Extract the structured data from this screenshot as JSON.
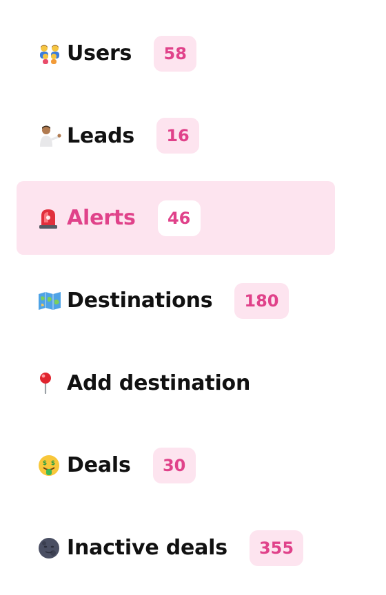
{
  "nav": {
    "items": [
      {
        "icon": "family-icon",
        "emoji": "👨‍👩‍👧‍👦",
        "label": "Users",
        "count": "58",
        "active": false
      },
      {
        "icon": "person-tipping-hand-icon",
        "emoji": "💁🏽‍♂️",
        "label": "Leads",
        "count": "16",
        "active": false
      },
      {
        "icon": "police-light-icon",
        "emoji": "🚨",
        "label": "Alerts",
        "count": "46",
        "active": true
      },
      {
        "icon": "world-map-icon",
        "emoji": "🗺️",
        "label": "Destinations",
        "count": "180",
        "active": false
      },
      {
        "icon": "round-pushpin-icon",
        "emoji": "📍",
        "label": "Add destination",
        "count": null,
        "active": false
      },
      {
        "icon": "money-mouth-face-icon",
        "emoji": "🤑",
        "label": "Deals",
        "count": "30",
        "active": false
      },
      {
        "icon": "new-moon-face-icon",
        "emoji": "🌚",
        "label": "Inactive deals",
        "count": "355",
        "active": false
      }
    ]
  },
  "colors": {
    "accent": "#e0428a",
    "active_background": "#fde4ef",
    "badge_background": "#fde4ef",
    "text": "#111111"
  }
}
